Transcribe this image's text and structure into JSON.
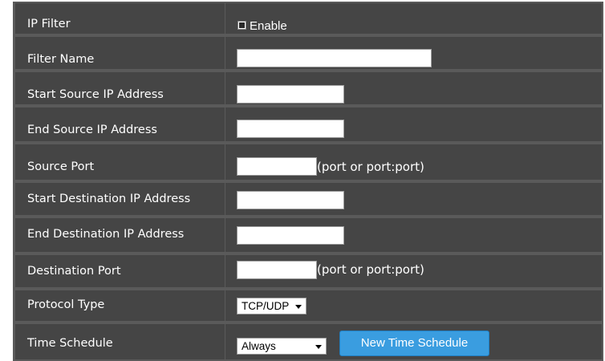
{
  "form": {
    "ip_filter": {
      "label": "IP Filter",
      "checkbox_label": "Enable",
      "checked": false
    },
    "filter_name": {
      "label": "Filter Name",
      "value": ""
    },
    "start_source_ip": {
      "label": "Start Source IP Address",
      "value": ""
    },
    "end_source_ip": {
      "label": "End Source IP Address",
      "value": ""
    },
    "source_port": {
      "label": "Source Port",
      "value": "",
      "hint": "(port or port:port)"
    },
    "start_destination_ip": {
      "label": "Start Destination IP Address",
      "value": ""
    },
    "end_destination_ip": {
      "label": "End Destination IP Address",
      "value": ""
    },
    "destination_port": {
      "label": "Destination Port",
      "value": "",
      "hint": "(port or port:port)"
    },
    "protocol_type": {
      "label": "Protocol Type",
      "selected": "TCP/UDP"
    },
    "time_schedule": {
      "label": "Time Schedule",
      "selected": "Always",
      "button_label": "New Time Schedule"
    }
  },
  "colors": {
    "panel_bg": "#5a5a5a",
    "cell_bg": "#454545",
    "button_bg": "#3a9de0",
    "text": "#ffffff"
  }
}
